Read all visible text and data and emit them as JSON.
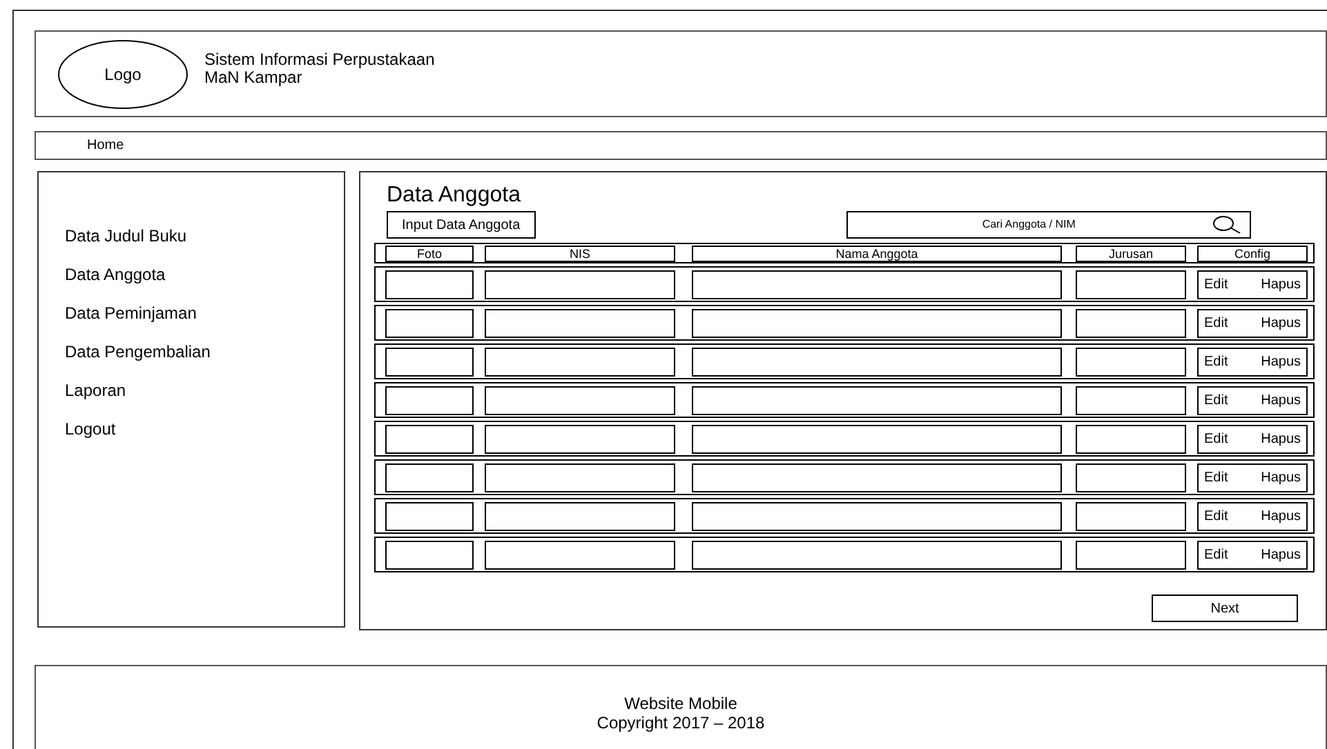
{
  "header": {
    "logo": "Logo",
    "title_line_1": "Sistem Informasi Perpustakaan",
    "title_line_2": "MaN Kampar"
  },
  "nav": {
    "items": [
      "Home"
    ]
  },
  "sidebar": {
    "items": [
      "Data Judul Buku",
      "Data Anggota",
      "Data Peminjaman",
      "Data Pengembalian",
      "Laporan",
      "Logout"
    ]
  },
  "main": {
    "title": "Data Anggota",
    "input_button": "Input Data Anggota",
    "search": {
      "placeholder": "Cari Anggota / NIM"
    },
    "table": {
      "columns": [
        "Foto",
        "NIS",
        "Nama Anggota",
        "Jurusan",
        "Config"
      ],
      "rows": [
        {
          "actions": [
            "Edit",
            "Hapus"
          ]
        },
        {
          "actions": [
            "Edit",
            "Hapus"
          ]
        },
        {
          "actions": [
            "Edit",
            "Hapus"
          ]
        },
        {
          "actions": [
            "Edit",
            "Hapus"
          ]
        },
        {
          "actions": [
            "Edit",
            "Hapus"
          ]
        },
        {
          "actions": [
            "Edit",
            "Hapus"
          ]
        },
        {
          "actions": [
            "Edit",
            "Hapus"
          ]
        },
        {
          "actions": [
            "Edit",
            "Hapus"
          ]
        }
      ]
    },
    "next_button": "Next"
  },
  "footer": {
    "line_1": "Website Mobile",
    "line_2": "Copyright 2017 – 2018"
  }
}
